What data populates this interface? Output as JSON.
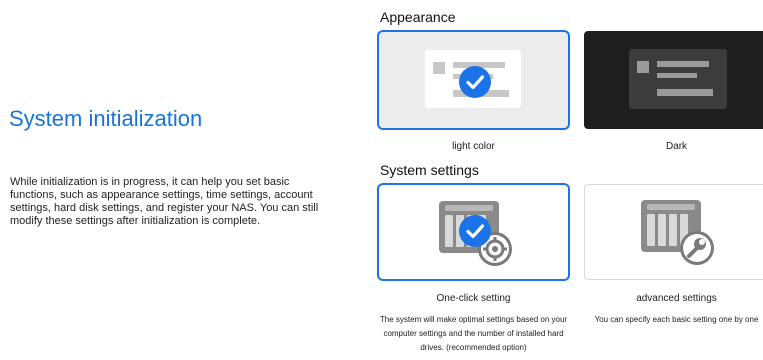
{
  "left": {
    "title": "System initialization",
    "description": "While initialization is in progress, it can help you set basic functions, such as appearance settings, time settings, account settings, hard disk settings, and register your NAS. You can still modify these settings after initialization is complete."
  },
  "appearance": {
    "heading": "Appearance",
    "options": [
      {
        "label": "light color",
        "selected": true
      },
      {
        "label": "Dark",
        "selected": false
      }
    ]
  },
  "system_settings": {
    "heading": "System settings",
    "options": [
      {
        "label": "One-click setting",
        "description": "The system will make optimal settings based on your computer settings and the number of installed hard drives. (recommended option)",
        "selected": true
      },
      {
        "label": "advanced settings",
        "description": "You can specify each basic setting one by one",
        "selected": false
      }
    ]
  },
  "colors": {
    "accent": "#1a73e8",
    "title_blue": "#1a73d9",
    "dark_card": "#1e1e1e"
  },
  "icons": [
    "check-icon",
    "nas-gear-icon",
    "nas-wrench-icon"
  ]
}
